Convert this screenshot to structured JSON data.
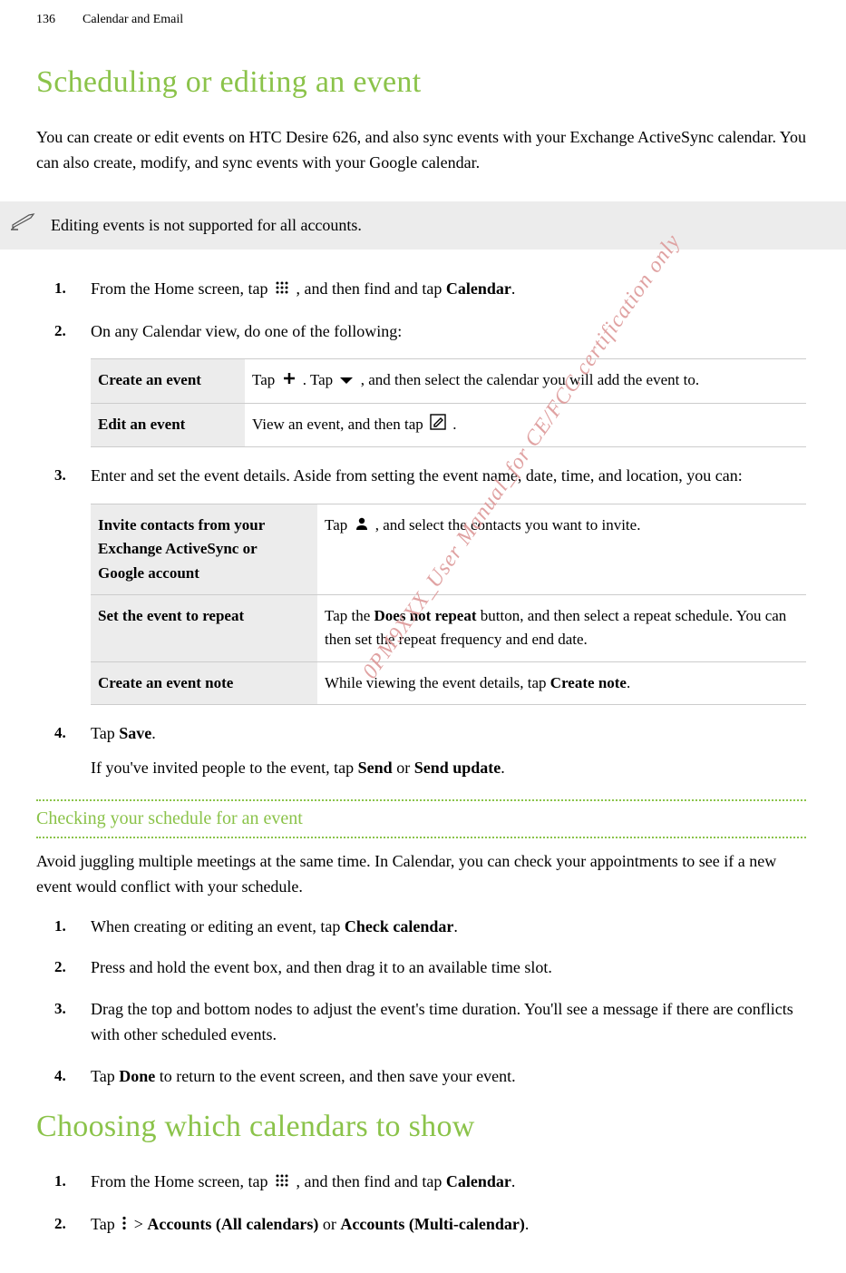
{
  "header": {
    "page_number": "136",
    "section": "Calendar and Email"
  },
  "h1_a": "Scheduling or editing an event",
  "intro": "You can create or edit events on HTC Desire 626, and also sync events with your Exchange ActiveSync calendar. You can also create, modify, and sync events with your Google calendar.",
  "note": "Editing events is not supported for all accounts.",
  "step1": {
    "num": "1.",
    "pre": "From the Home screen, tap ",
    "post": " , and then find and tap ",
    "bold": "Calendar",
    "end": "."
  },
  "step2": {
    "num": "2.",
    "text": "On any Calendar view, do one of the following:"
  },
  "table1": {
    "r1_label": "Create an event",
    "r1_pre": "Tap ",
    "r1_mid": ". Tap ",
    "r1_post": " , and then select the calendar you will add the event to.",
    "r2_label": "Edit an event",
    "r2_pre": "View an event, and then tap ",
    "r2_post": "."
  },
  "step3": {
    "num": "3.",
    "text": "Enter and set the event details. Aside from setting the event name, date, time, and location, you can:"
  },
  "table2": {
    "r1_label": "Invite contacts from your Exchange ActiveSync or Google account",
    "r1_pre": "Tap ",
    "r1_post": " , and select the contacts you want to invite.",
    "r2_label": "Set the event to repeat",
    "r2_pre": "Tap the ",
    "r2_bold": "Does not repeat",
    "r2_post": " button, and then select a repeat schedule. You can then set the repeat frequency and end date.",
    "r3_label": "Create an event note",
    "r3_pre": "While viewing the event details, tap ",
    "r3_bold": "Create note",
    "r3_post": "."
  },
  "step4": {
    "num": "4.",
    "pre": "Tap ",
    "bold": "Save",
    "end": ".",
    "sub_pre": "If you've invited people to the event, tap ",
    "sub_b1": "Send",
    "sub_or": " or ",
    "sub_b2": "Send update",
    "sub_end": "."
  },
  "h2_a": "Checking your schedule for an event",
  "body_a": "Avoid juggling multiple meetings at the same time. In Calendar, you can check your appointments to see if a new event would conflict with your schedule.",
  "checks": {
    "s1": {
      "num": "1.",
      "pre": "When creating or editing an event, tap ",
      "bold": "Check calendar",
      "end": "."
    },
    "s2": {
      "num": "2.",
      "text": "Press and hold the event box, and then drag it to an available time slot."
    },
    "s3": {
      "num": "3.",
      "text": "Drag the top and bottom nodes to adjust the event's time duration. You'll see a message if there are conflicts with other scheduled events."
    },
    "s4": {
      "num": "4.",
      "pre": "Tap ",
      "bold": "Done",
      "end": " to return to the event screen, and then save your event."
    }
  },
  "h1_b": "Choosing which calendars to show",
  "show_steps": {
    "s1": {
      "num": "1.",
      "pre": "From the Home screen, tap ",
      "post": " , and then find and tap ",
      "bold": "Calendar",
      "end": "."
    },
    "s2": {
      "num": "2.",
      "pre": "Tap ",
      "mid": "  > ",
      "b1": "Accounts (All calendars)",
      "or": " or ",
      "b2": "Accounts (Multi-calendar)",
      "end": "."
    }
  },
  "watermark": "0PM9XXX_User Manual_for CE/FCC certification only"
}
